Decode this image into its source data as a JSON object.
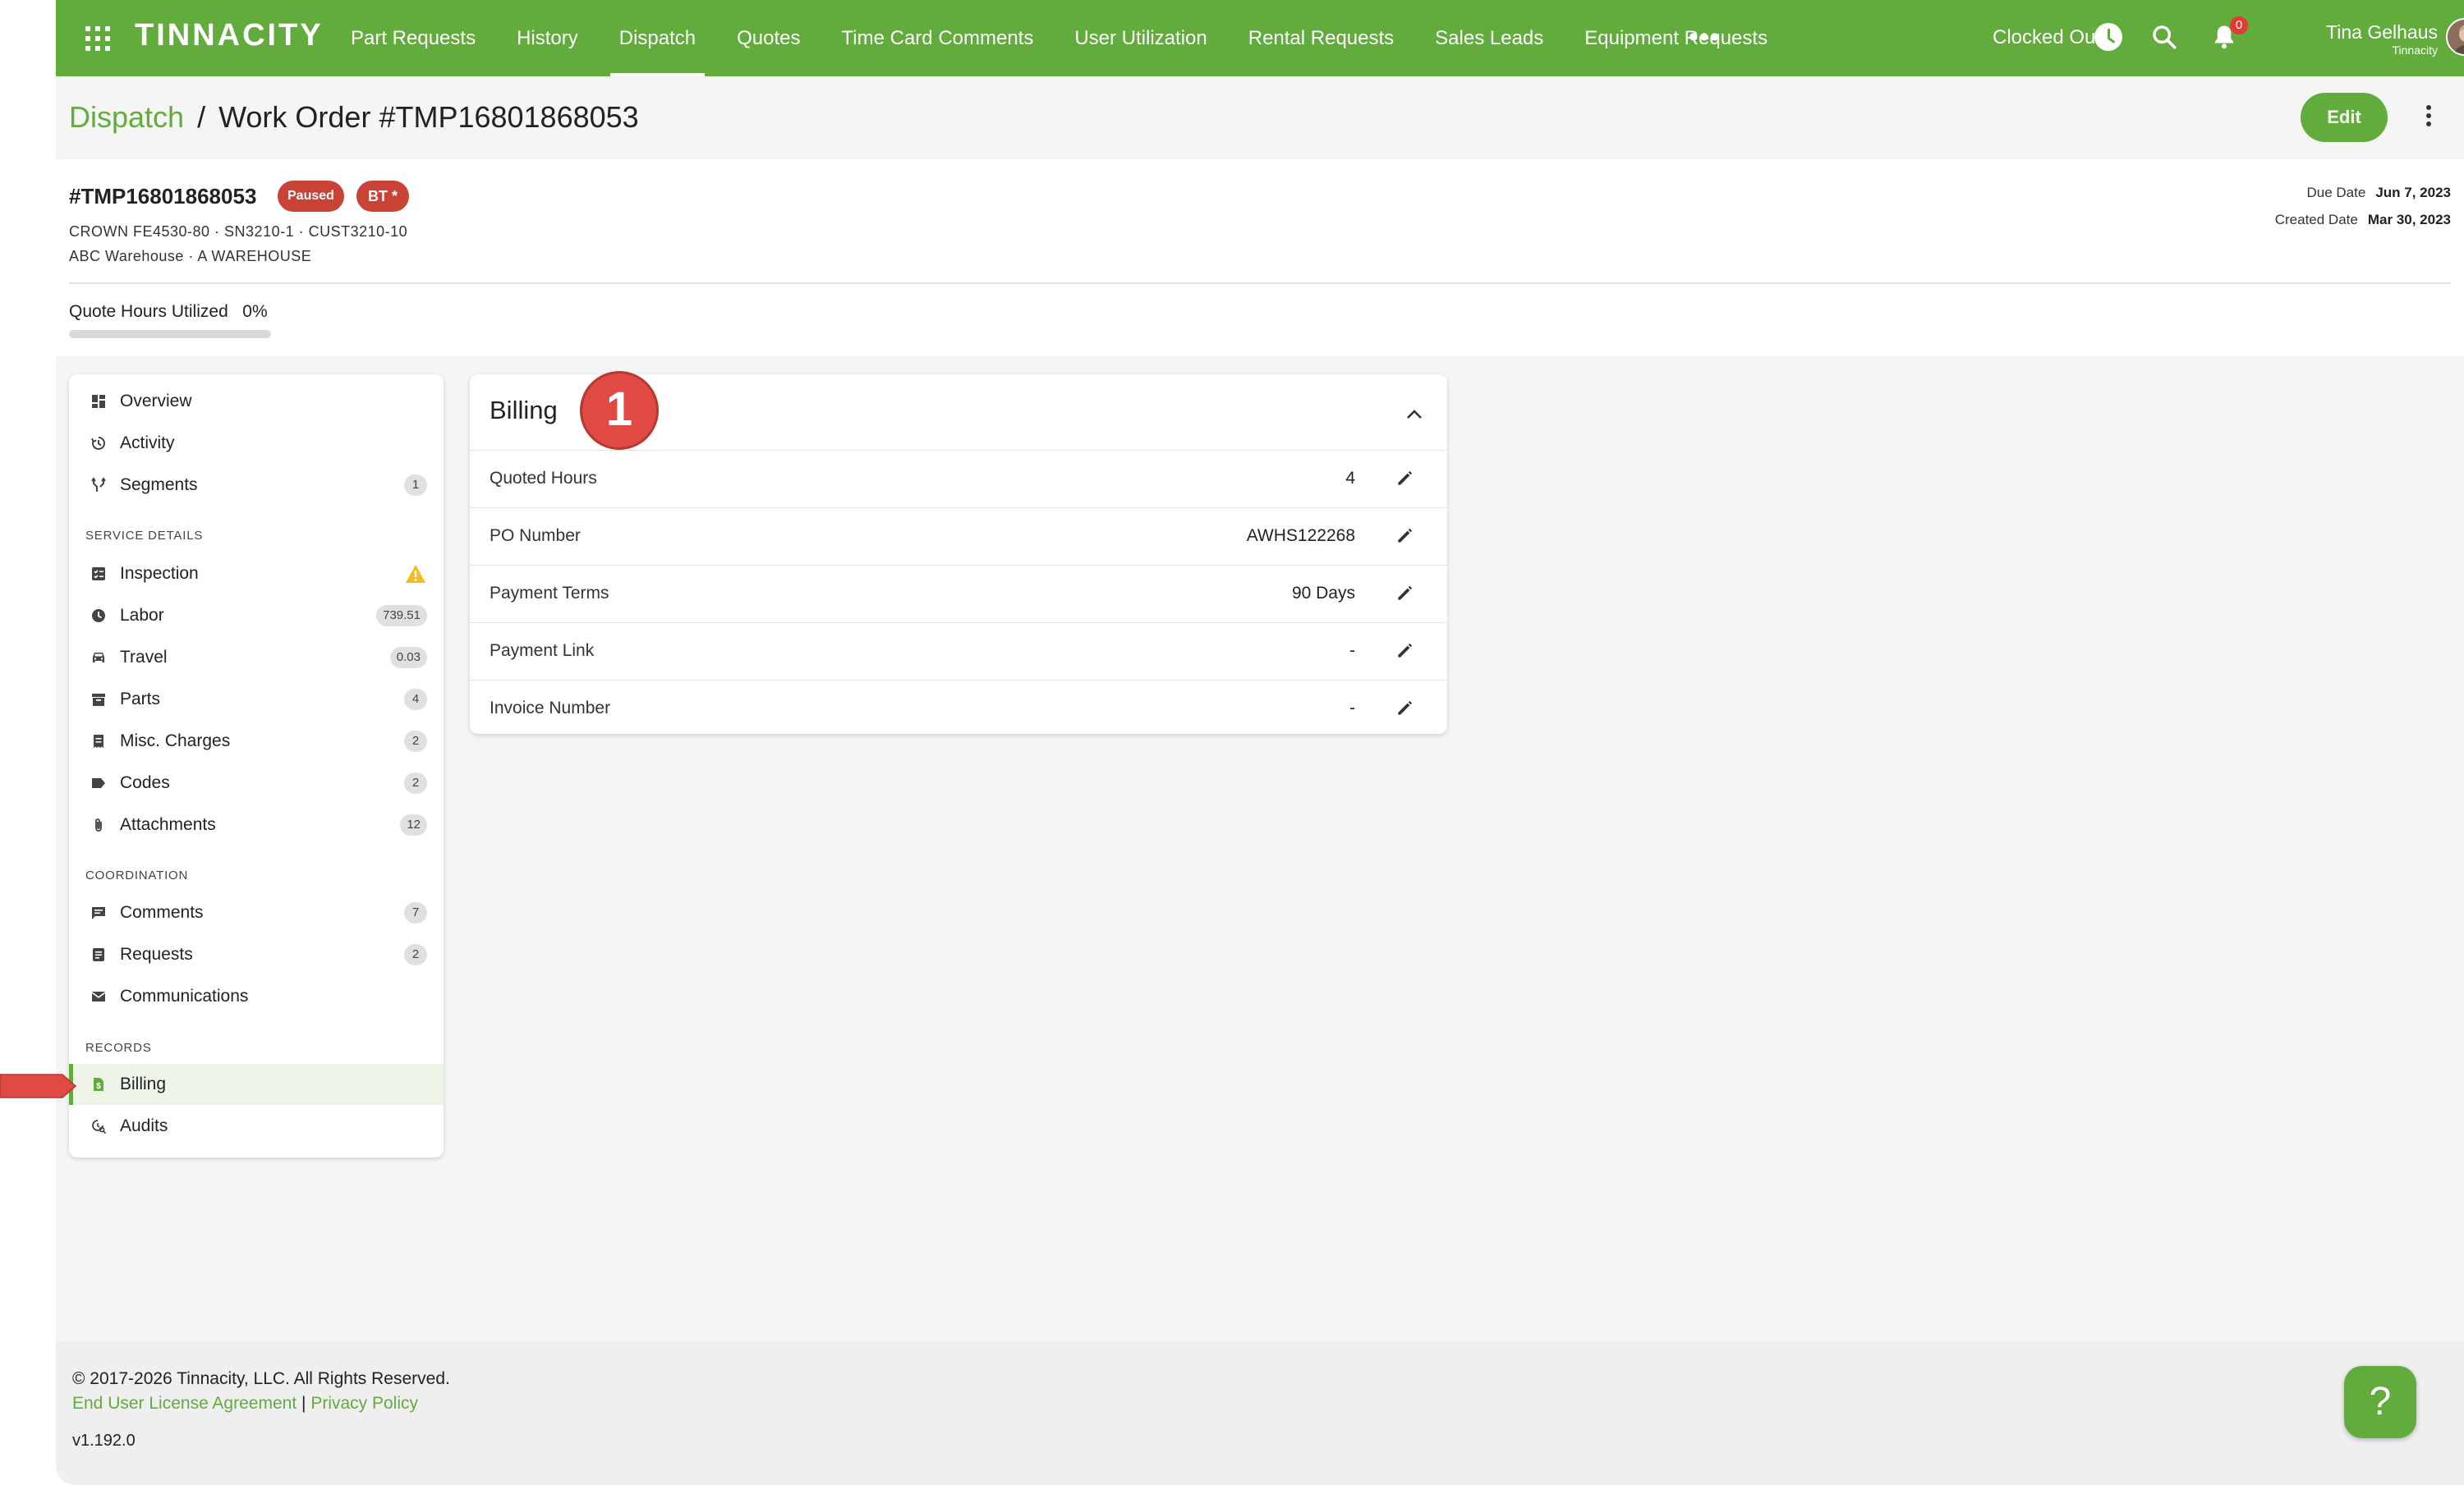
{
  "topbar": {
    "logo": "TINNACITY",
    "nav": [
      "Part Requests",
      "History",
      "Dispatch",
      "Quotes",
      "Time Card Comments",
      "User Utilization",
      "Rental Requests",
      "Sales Leads",
      "Equipment Requests"
    ],
    "active_nav": "Dispatch",
    "more": "•••",
    "clock_status": "Clocked Out",
    "notifications": "0",
    "user_name": "Tina Gelhaus",
    "user_org": "Tinnacity"
  },
  "breadcrumb": {
    "parent": "Dispatch",
    "separator": "/",
    "current": "Work Order #TMP16801868053"
  },
  "actions": {
    "edit": "Edit"
  },
  "work_order": {
    "number": "#TMP16801868053",
    "status": "Paused",
    "tag": "BT *",
    "equipment": "CROWN FE4530-80 · SN3210-1 · CUST3210-10",
    "location": "ABC Warehouse · A WAREHOUSE",
    "due_label": "Due Date",
    "due_value": "Jun 7, 2023",
    "created_label": "Created Date",
    "created_value": "Mar 30, 2023",
    "quote_hours_label": "Quote Hours Utilized",
    "quote_hours_value": "0%",
    "quote_hours_fraction": 0
  },
  "sidebar": {
    "overview": "Overview",
    "activity": "Activity",
    "segments": {
      "label": "Segments",
      "count": "1"
    },
    "service_details_heading": "SERVICE DETAILS",
    "inspection": "Inspection",
    "labor": {
      "label": "Labor",
      "count": "739.51"
    },
    "travel": {
      "label": "Travel",
      "count": "0.03"
    },
    "parts": {
      "label": "Parts",
      "count": "4"
    },
    "misc": {
      "label": "Misc. Charges",
      "count": "2"
    },
    "codes": {
      "label": "Codes",
      "count": "2"
    },
    "attachments": {
      "label": "Attachments",
      "count": "12"
    },
    "coordination_heading": "COORDINATION",
    "comments": {
      "label": "Comments",
      "count": "7"
    },
    "requests": {
      "label": "Requests",
      "count": "2"
    },
    "communications": "Communications",
    "records_heading": "RECORDS",
    "billing": "Billing",
    "audits": "Audits"
  },
  "billing": {
    "title": "Billing",
    "step": "1",
    "rows": [
      {
        "label": "Quoted Hours",
        "value": "4"
      },
      {
        "label": "PO Number",
        "value": "AWHS122268"
      },
      {
        "label": "Payment Terms",
        "value": "90 Days"
      },
      {
        "label": "Payment Link",
        "value": "-"
      },
      {
        "label": "Invoice Number",
        "value": "-"
      }
    ]
  },
  "footer": {
    "copyright": "© 2017-2026 Tinnacity, LLC. All Rights Reserved.",
    "eula": "End User License Agreement",
    "divider": "|",
    "privacy": "Privacy Policy",
    "version": "v1.192.0",
    "help": "?"
  },
  "colors": {
    "brand_green": "#62ab3d",
    "danger_red": "#c94236",
    "step_red": "#e04a42"
  }
}
